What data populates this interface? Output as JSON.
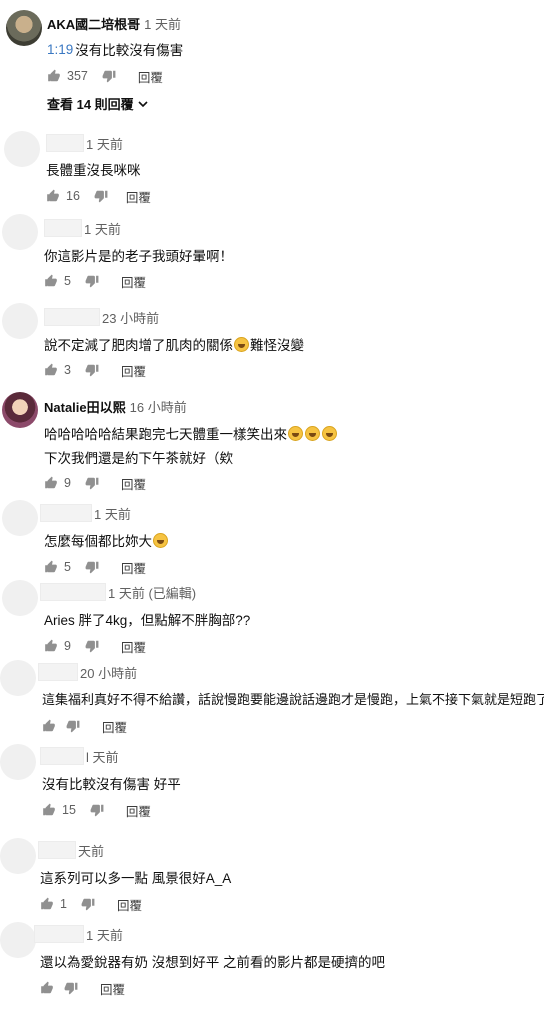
{
  "comments": [
    {
      "author": "AKA國二培根哥",
      "time": "1 天前",
      "timelink": "1:19",
      "lines": [
        "沒有比較沒有傷害"
      ],
      "likes": "357",
      "reply": "回覆",
      "view_replies": "查看 14 則回覆"
    },
    {
      "author": "",
      "time": "1 天前",
      "lines": [
        "長體重沒長咪咪"
      ],
      "likes": "16",
      "reply": "回覆"
    },
    {
      "author": "",
      "time": "1 天前",
      "lines": [
        "你這影片是的老子我頭好暈啊！"
      ],
      "likes": "5",
      "reply": "回覆"
    },
    {
      "author": "",
      "time": "23 小時前",
      "lines": [
        "說不定減了肥肉增了肌肉的關係",
        "難怪沒變"
      ],
      "likes": "3",
      "reply": "回覆"
    },
    {
      "author": "Natalie田以熙",
      "time": "16 小時前",
      "lines": [
        "哈哈哈哈哈結果跑完七天體重一樣笑出來",
        "下次我們還是約下午茶就好（欸"
      ],
      "likes": "9",
      "reply": "回覆"
    },
    {
      "author": "",
      "time": "1 天前",
      "lines": [
        "怎麼每個都比妳大"
      ],
      "likes": "5",
      "reply": "回覆"
    },
    {
      "author": "",
      "time": "1 天前 (已編輯)",
      "lines": [
        "Aries 胖了4kg，但點解不胖胸部??"
      ],
      "likes": "9",
      "reply": "回覆"
    },
    {
      "author": "",
      "time": "20 小時前",
      "lines": [
        "這集福利真好不得不給讚，話說慢跑要能邊說話邊跑才是慢跑，上氣不接下氣就是短跑了。"
      ],
      "likes": "",
      "reply": "回覆"
    },
    {
      "author": "",
      "time": "l 天前",
      "lines": [
        "沒有比較沒有傷害 好平"
      ],
      "likes": "15",
      "reply": "回覆"
    },
    {
      "author": "",
      "time": "天前",
      "lines": [
        "這系列可以多一點 風景很好A_A"
      ],
      "likes": "1",
      "reply": "回覆"
    },
    {
      "author": "",
      "time": "1 天前",
      "lines": [
        "還以為愛銳器有奶 沒想到好平 之前看的影片都是硬擠的吧"
      ],
      "likes": "",
      "reply": "回覆"
    }
  ],
  "icons": {
    "like": "thumbs-up-icon",
    "dislike": "thumbs-down-icon",
    "expand": "chevron-down-icon"
  }
}
